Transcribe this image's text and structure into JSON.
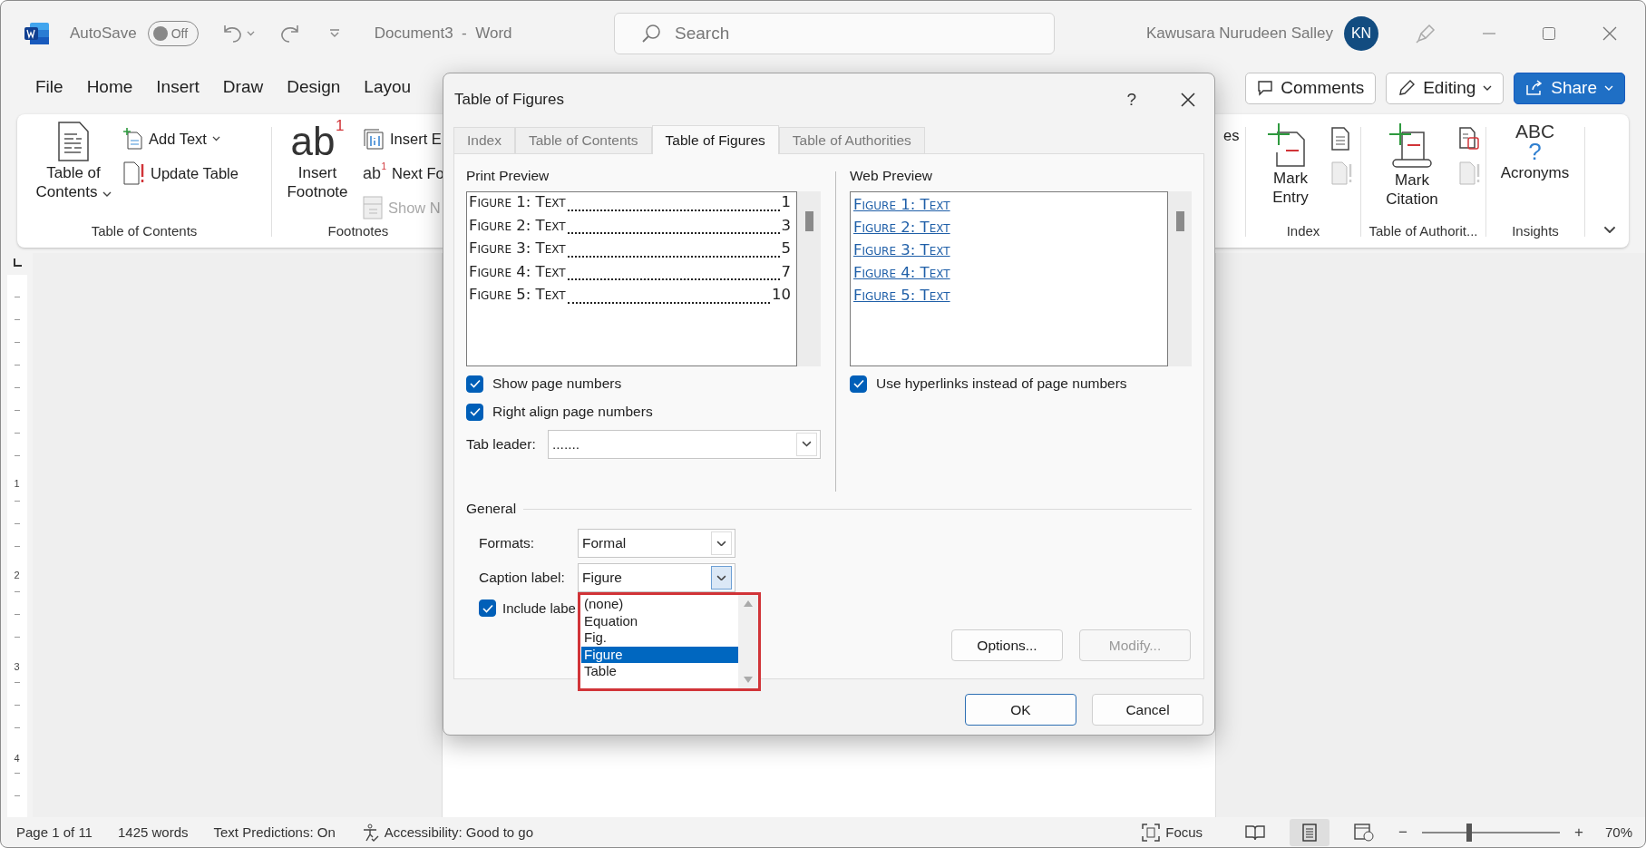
{
  "window": {
    "document_title": "Document3  -  Word"
  },
  "title_bar": {
    "autosave": {
      "label": "AutoSave",
      "on": false,
      "state": "Off"
    },
    "search": {
      "placeholder": "Search"
    },
    "user": {
      "name": "Kawusara Nurudeen Salley",
      "initials": "KN"
    }
  },
  "menu_tabs": [
    {
      "label": "File",
      "selected": false
    },
    {
      "label": "Home",
      "selected": false
    },
    {
      "label": "Insert",
      "selected": false
    },
    {
      "label": "Draw",
      "selected": false
    },
    {
      "label": "Design",
      "selected": false
    },
    {
      "label": "Layou",
      "selected": false
    }
  ],
  "header_buttons": [
    {
      "kind": "comments",
      "label": "Comments"
    },
    {
      "kind": "editing",
      "label": "Editing"
    },
    {
      "kind": "share",
      "label": "Share"
    }
  ],
  "ribbon": {
    "left_groups": [
      {
        "label": "Table of Contents",
        "items": [
          {
            "kind": "large",
            "label": "Table of Contents",
            "caret": true,
            "disabled": false
          },
          {
            "kind": "small",
            "label": "Add Text",
            "caret": true,
            "disabled": false
          },
          {
            "kind": "small",
            "label": "Update Table",
            "caret": false,
            "disabled": false
          }
        ]
      },
      {
        "label": "Footnotes",
        "items": [
          {
            "kind": "large",
            "label": "Insert Footnote",
            "caret": false,
            "disabled": false,
            "icon_text": "ab",
            "icon_sup": "1"
          },
          {
            "kind": "small",
            "label": "Insert E",
            "caret": false,
            "disabled": false
          },
          {
            "kind": "small",
            "label": "Next Fo",
            "caret": false,
            "disabled": false,
            "icon_text": "ab",
            "icon_sup": "1"
          },
          {
            "kind": "small",
            "label": "Show N",
            "caret": false,
            "disabled": true
          }
        ]
      }
    ],
    "fragment": "es",
    "right_groups": [
      {
        "label": "Index",
        "items": [
          {
            "kind": "large",
            "label": "Mark Entry",
            "caret": false,
            "disabled": false
          },
          {
            "kind": "icon",
            "disabled": false
          },
          {
            "kind": "icon",
            "disabled": true
          }
        ]
      },
      {
        "label": "Table of Authorit...",
        "items": [
          {
            "kind": "large",
            "label": "Mark Citation",
            "caret": false,
            "disabled": false
          },
          {
            "kind": "icon",
            "disabled": false
          },
          {
            "kind": "icon",
            "disabled": true
          }
        ]
      },
      {
        "label": "Insights",
        "items": [
          {
            "kind": "large",
            "label": "Acronyms",
            "caret": false,
            "disabled": false,
            "icon_text": "ABC",
            "icon_sub": "?"
          }
        ]
      }
    ]
  },
  "ruler": {
    "numbers": [
      "1",
      "2",
      "3",
      "4"
    ]
  },
  "dialog": {
    "title": "Table of Figures",
    "help": "?",
    "tabs": [
      {
        "label": "Index",
        "selected": false
      },
      {
        "label": "Table of Contents",
        "selected": false
      },
      {
        "label": "Table of Figures",
        "selected": true
      },
      {
        "label": "Table of Authorities",
        "selected": false
      }
    ],
    "print_preview": {
      "label": "Print Preview",
      "entries": [
        {
          "caption": "Figure 1: Text",
          "page": "1"
        },
        {
          "caption": "Figure 2: Text",
          "page": "3"
        },
        {
          "caption": "Figure 3: Text",
          "page": "5"
        },
        {
          "caption": "Figure 4: Text",
          "page": "7"
        },
        {
          "caption": "Figure 5: Text",
          "page": "10"
        }
      ]
    },
    "print_options": [
      {
        "label": "Show page numbers",
        "checked": true
      },
      {
        "label": "Right align page numbers",
        "checked": true
      }
    ],
    "tab_leader": {
      "label": "Tab leader:",
      "value": "......."
    },
    "web_preview": {
      "label": "Web Preview",
      "entries": [
        "Figure 1: Text",
        "Figure 2: Text",
        "Figure 3: Text",
        "Figure 4: Text",
        "Figure 5: Text"
      ]
    },
    "web_option": {
      "label": "Use hyperlinks instead of page numbers",
      "checked": true
    },
    "general": {
      "label": "General",
      "formats": {
        "label": "Formats:",
        "value": "Formal"
      },
      "caption_label": {
        "label": "Caption label:",
        "value": "Figure",
        "expanded": true,
        "options": [
          {
            "label": "(none)",
            "selected": false
          },
          {
            "label": "Equation",
            "selected": false
          },
          {
            "label": "Fig.",
            "selected": false
          },
          {
            "label": "Figure",
            "selected": true
          },
          {
            "label": "Table",
            "selected": false
          }
        ]
      },
      "include_label": {
        "label": "Include labe",
        "checked": true
      }
    },
    "buttons": [
      {
        "label": "Options...",
        "disabled": false
      },
      {
        "label": "Modify...",
        "disabled": true
      }
    ],
    "footer_buttons": [
      {
        "label": "OK",
        "default": true
      },
      {
        "label": "Cancel",
        "default": false
      }
    ]
  },
  "status_bar": {
    "page": "Page 1 of 11",
    "words": "1425 words",
    "predictions": "Text Predictions: On",
    "accessibility": "Accessibility: Good to go",
    "focus": "Focus",
    "views": [
      {
        "selected": false
      },
      {
        "selected": true
      },
      {
        "selected": false
      }
    ],
    "zoom": {
      "minus": "−",
      "plus": "+",
      "level": 0.34,
      "value": "70%"
    }
  }
}
